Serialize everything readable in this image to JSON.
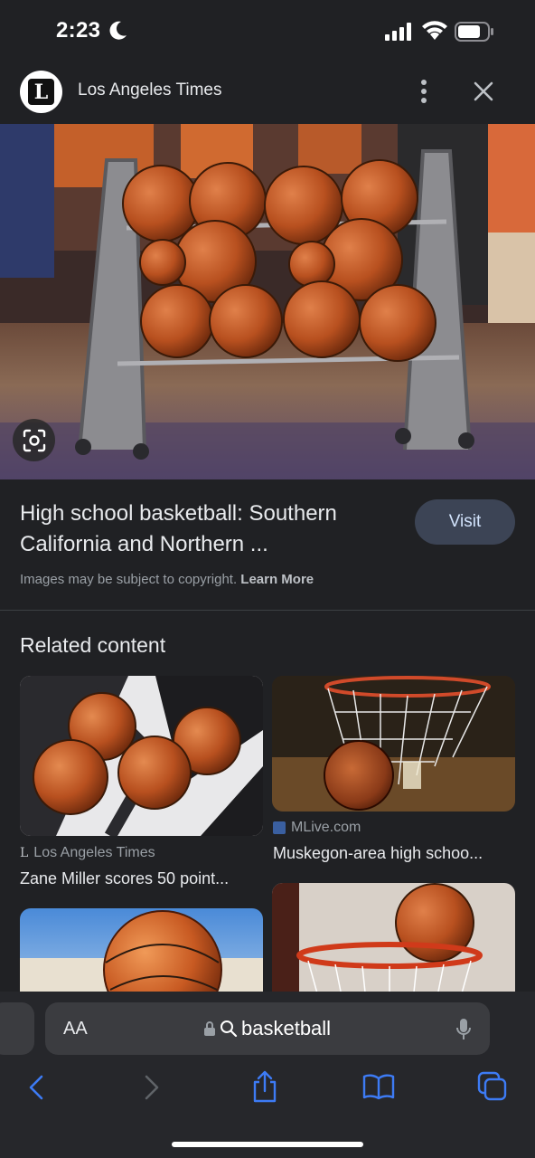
{
  "status": {
    "time": "2:23"
  },
  "header": {
    "source_name": "Los Angeles Times",
    "logo_letter": "L"
  },
  "result": {
    "title": "High school basketball: Southern California and Northern ...",
    "visit_label": "Visit",
    "copyright_text": "Images may be subject to copyright.",
    "learn_more": "Learn More"
  },
  "related": {
    "heading": "Related content",
    "cards": [
      {
        "source": "Los Angeles Times",
        "title": "Zane Miller scores 50 point..."
      },
      {
        "source": "MLive.com",
        "title": "Muskegon-area high schoo..."
      }
    ]
  },
  "browser": {
    "aa_label": "AA",
    "address": "basketball"
  },
  "colors": {
    "accent": "#3d7bf5",
    "background": "#202124",
    "visit_bg": "#3c4455"
  }
}
